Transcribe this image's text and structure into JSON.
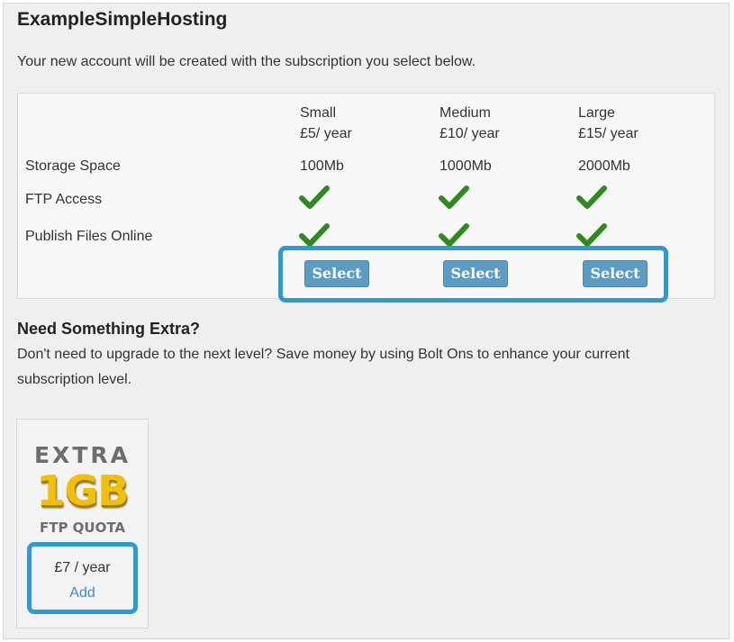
{
  "app": {
    "title": "ExampleSimpleHosting"
  },
  "intro": "Your new account will be created with the subscription you select below.",
  "plans": [
    {
      "name": "Small",
      "price": "£5/ year",
      "storage": "100Mb",
      "ftp": true,
      "publish": true,
      "select_label": "Select"
    },
    {
      "name": "Medium",
      "price": "£10/ year",
      "storage": "1000Mb",
      "ftp": true,
      "publish": true,
      "select_label": "Select"
    },
    {
      "name": "Large",
      "price": "£15/ year",
      "storage": "2000Mb",
      "ftp": true,
      "publish": true,
      "select_label": "Select"
    }
  ],
  "features": [
    "Storage Space",
    "FTP Access",
    "Publish Files Online"
  ],
  "extra": {
    "heading": "Need Something Extra?",
    "description": "Don't need to upgrade to the next level? Save money by using Bolt Ons to enhance your current subscription level.",
    "bolton": {
      "image_text_top": "EXTRA",
      "image_text_big": "1GB",
      "image_text_bottom": "FTP QUOTA",
      "price": "£7 / year",
      "add_label": "Add"
    }
  },
  "colors": {
    "highlight": "#2b9bd8",
    "button": "#5b9cc2",
    "check": "#2f8a1d",
    "link": "#3d8cc8"
  },
  "icons": {
    "feature_included": "checkmark-icon"
  }
}
